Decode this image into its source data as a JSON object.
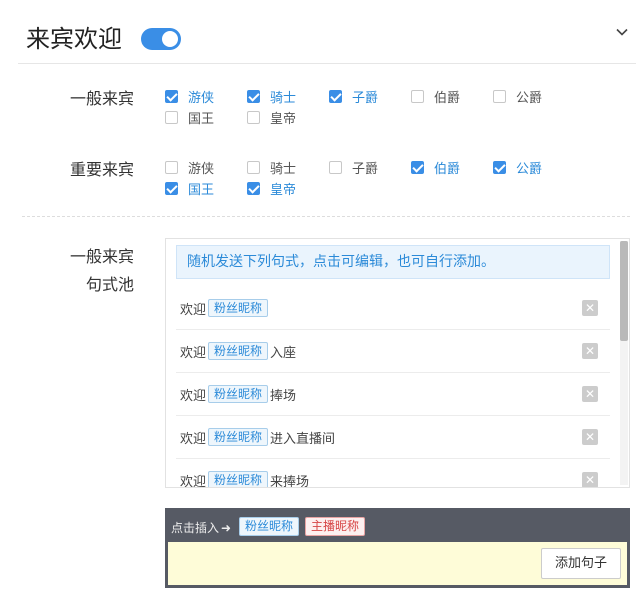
{
  "header": {
    "title": "来宾欢迎",
    "toggle_on": true
  },
  "general_guests": {
    "label": "一般来宾",
    "options": [
      {
        "label": "游侠",
        "checked": true
      },
      {
        "label": "骑士",
        "checked": true
      },
      {
        "label": "子爵",
        "checked": true
      },
      {
        "label": "伯爵",
        "checked": false
      },
      {
        "label": "公爵",
        "checked": false
      },
      {
        "label": "国王",
        "checked": false
      },
      {
        "label": "皇帝",
        "checked": false
      }
    ]
  },
  "important_guests": {
    "label": "重要来宾",
    "options": [
      {
        "label": "游侠",
        "checked": false
      },
      {
        "label": "骑士",
        "checked": false
      },
      {
        "label": "子爵",
        "checked": false
      },
      {
        "label": "伯爵",
        "checked": true
      },
      {
        "label": "公爵",
        "checked": true
      },
      {
        "label": "国王",
        "checked": true
      },
      {
        "label": "皇帝",
        "checked": true
      }
    ]
  },
  "pool": {
    "label_line1": "一般来宾",
    "label_line2": "句式池",
    "hint": "随机发送下列句式，点击可编辑，也可自行添加。",
    "tag_fan": "粉丝昵称",
    "rows": [
      {
        "prefix": "欢迎",
        "suffix": ""
      },
      {
        "prefix": "欢迎",
        "suffix": "入座"
      },
      {
        "prefix": "欢迎",
        "suffix": "捧场"
      },
      {
        "prefix": "欢迎",
        "suffix": "进入直播间"
      },
      {
        "prefix": "欢迎",
        "suffix": "来捧场"
      }
    ]
  },
  "insert_bar": {
    "label": "点击插入",
    "tag_fan": "粉丝昵称",
    "tag_host": "主播昵称",
    "add_button": "添加句子"
  }
}
